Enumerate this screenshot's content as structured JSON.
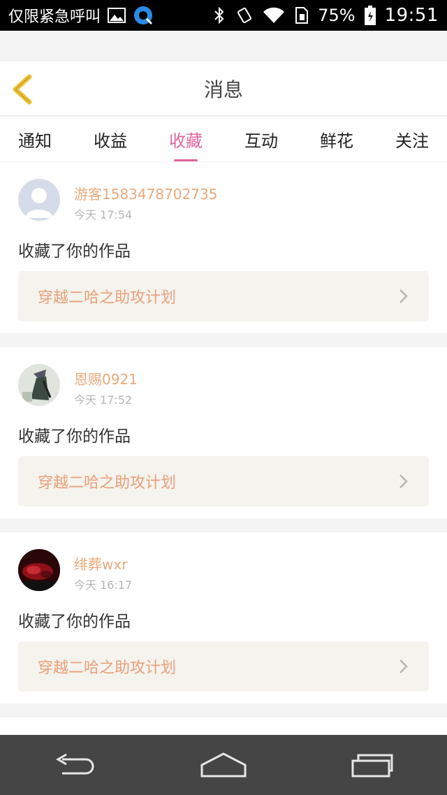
{
  "status_bar": {
    "left_text": "仅限紧急呼叫",
    "battery_percent": "75%",
    "time": "19:51",
    "icons": [
      "image-icon",
      "app-icon",
      "bluetooth-icon",
      "vibrate-icon",
      "wifi-icon",
      "sim-icon",
      "battery-icon"
    ]
  },
  "header": {
    "title": "消息",
    "back_icon": "chevron-left-icon"
  },
  "tabs": [
    {
      "label": "通知",
      "active": false
    },
    {
      "label": "收益",
      "active": false
    },
    {
      "label": "收藏",
      "active": true
    },
    {
      "label": "互动",
      "active": false
    },
    {
      "label": "鲜花",
      "active": false
    },
    {
      "label": "关注",
      "active": false
    }
  ],
  "messages": [
    {
      "user": "游客1583478702735",
      "time": "今天 17:54",
      "action": "收藏了你的作品",
      "work_title": "穿越二哈之助攻计划"
    },
    {
      "user": "恩赐0921",
      "time": "今天 17:52",
      "action": "收藏了你的作品",
      "work_title": "穿越二哈之助攻计划"
    },
    {
      "user": "绯葬wxr",
      "time": "今天 16:17",
      "action": "收藏了你的作品",
      "work_title": "穿越二哈之助攻计划"
    }
  ],
  "nav_bar": {
    "icons": [
      "back-icon",
      "home-icon",
      "recents-icon"
    ]
  },
  "colors": {
    "accent": "#e066a0",
    "username": "#e8a97a",
    "work_title": "#e9a07a",
    "work_bg": "#f5f3ee"
  }
}
